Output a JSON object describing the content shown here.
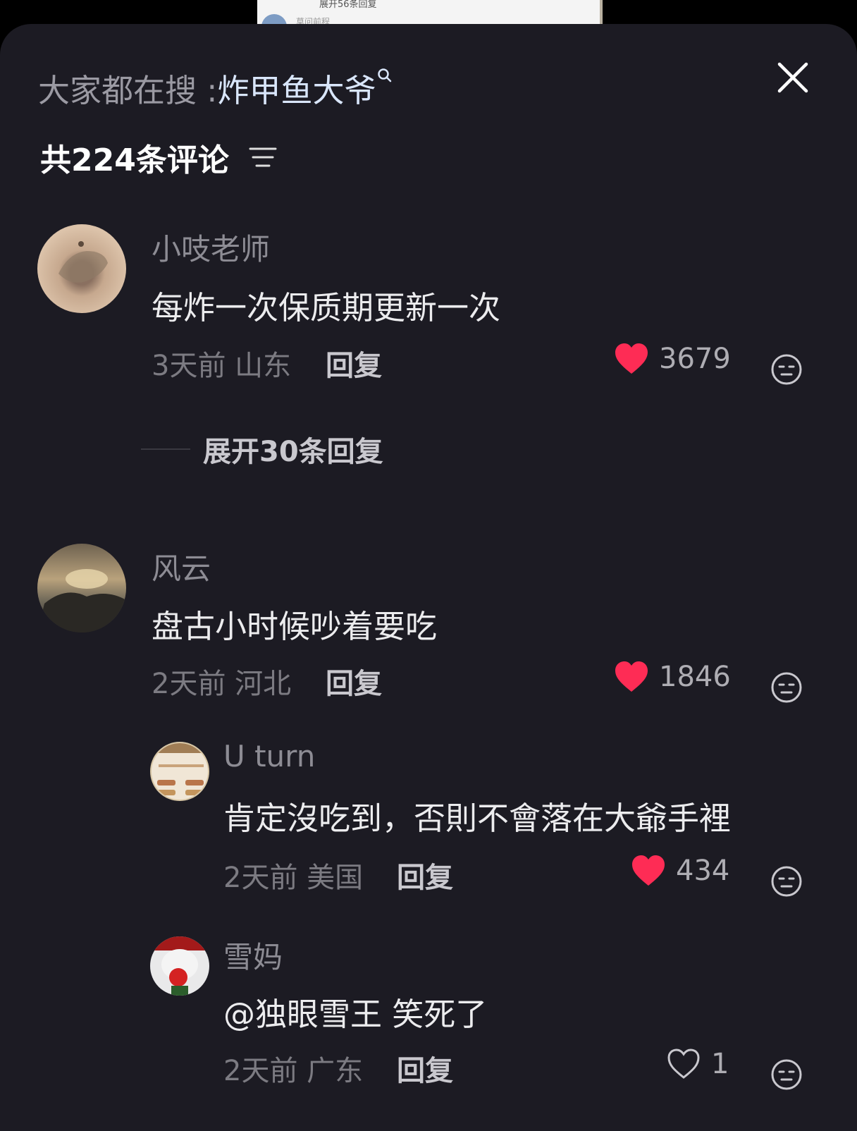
{
  "peek": {
    "text": "展开56条回复",
    "sub": "莫问前程"
  },
  "header": {
    "hot_prefix": "大家都在搜 : ",
    "hot_query": "炸甲鱼大爷",
    "total": "共224条评论"
  },
  "colors": {
    "like_red": "#fe2c55",
    "bg": "#1c1b23"
  },
  "comments": [
    {
      "user": "小吱老师",
      "text": "每炸一次保质期更新一次",
      "time": "3天前",
      "location": "山东",
      "reply_label": "回复",
      "likes": "3679",
      "liked": true,
      "expand_label": "展开30条回复"
    },
    {
      "user": "风云",
      "text": "盘古小时候吵着要吃",
      "time": "2天前",
      "location": "河北",
      "reply_label": "回复",
      "likes": "1846",
      "liked": true
    },
    {
      "user": "U turn",
      "text": "肯定沒吃到，否則不會落在大爺手裡",
      "time": "2天前",
      "location": "美国",
      "reply_label": "回复",
      "likes": "434",
      "liked": true
    },
    {
      "user": "雪妈",
      "text": "@独眼雪王  笑死了",
      "time": "2天前",
      "location": "广东",
      "reply_label": "回复",
      "likes": "1",
      "liked": false
    }
  ],
  "icons": [
    "search-icon",
    "close-icon",
    "filter-icon",
    "heart-filled-icon",
    "heart-outline-icon",
    "dislike-face-icon"
  ]
}
